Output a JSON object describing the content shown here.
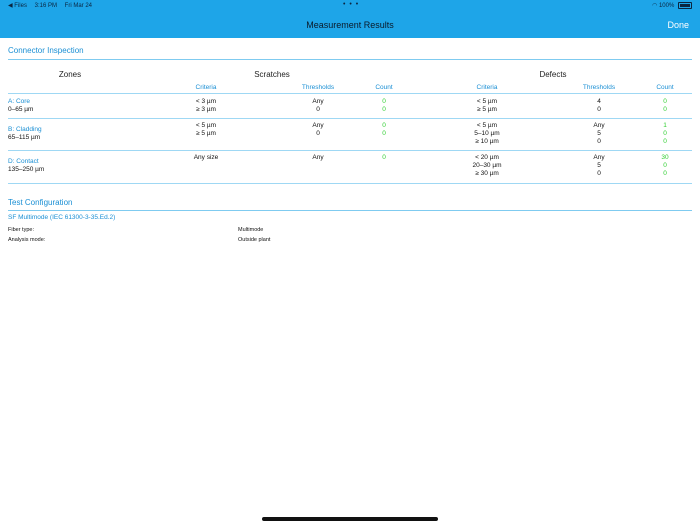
{
  "status_bar": {
    "back_app": "◀ Files",
    "time": "3:16 PM",
    "date": "Fri Mar 24",
    "dots": "• • •",
    "wifi": "◠",
    "battery_pct": "100%"
  },
  "nav": {
    "title": "Measurement Results",
    "done": "Done"
  },
  "inspection": {
    "title": "Connector Inspection",
    "headers": {
      "zones": "Zones",
      "scratches": "Scratches",
      "defects": "Defects",
      "criteria": "Criteria",
      "thresholds": "Thresholds",
      "count": "Count"
    },
    "rows": [
      {
        "zone": "A: Core",
        "range": "0–65 µm",
        "scratch_criteria": [
          "< 3 µm",
          "≥ 3 µm"
        ],
        "scratch_thresholds": [
          "Any",
          "0"
        ],
        "scratch_counts": [
          "0",
          "0"
        ],
        "defect_criteria": [
          "< 5 µm",
          "≥ 5 µm"
        ],
        "defect_thresholds": [
          "4",
          "0"
        ],
        "defect_counts": [
          "0",
          "0"
        ]
      },
      {
        "zone": "B: Cladding",
        "range": "65–115 µm",
        "scratch_criteria": [
          "< 5 µm",
          "≥ 5 µm"
        ],
        "scratch_thresholds": [
          "Any",
          "0"
        ],
        "scratch_counts": [
          "0",
          "0"
        ],
        "defect_criteria": [
          "< 5 µm",
          "5–10 µm",
          "≥ 10 µm"
        ],
        "defect_thresholds": [
          "Any",
          "5",
          "0"
        ],
        "defect_counts": [
          "1",
          "0",
          "0"
        ]
      },
      {
        "zone": "D: Contact",
        "range": "135–250 µm",
        "scratch_criteria": [
          "Any size"
        ],
        "scratch_thresholds": [
          "Any"
        ],
        "scratch_counts": [
          "0"
        ],
        "defect_criteria": [
          "< 20 µm",
          "20–30 µm",
          "≥ 30 µm"
        ],
        "defect_thresholds": [
          "Any",
          "5",
          "0"
        ],
        "defect_counts": [
          "30",
          "0",
          "0"
        ]
      }
    ]
  },
  "config": {
    "title": "Test Configuration",
    "profile_link": "SF Multimode  (IEC 61300-3-35.Ed.2)",
    "fiber_type_label": "Fiber type:",
    "fiber_type_value": "Multimode",
    "analysis_mode_label": "Analysis mode:",
    "analysis_mode_value": "Outside plant"
  },
  "colors": {
    "accent": "#1ea5e8",
    "link": "#1a8fd4",
    "pass_green": "#2fcf30"
  }
}
